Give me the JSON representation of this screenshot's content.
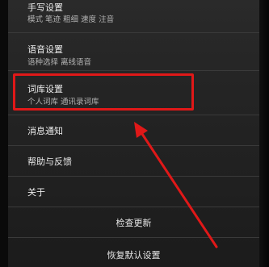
{
  "settings": {
    "items": [
      {
        "title": "手写设置",
        "subtitle": "模式 笔迹 粗细 速度 注音"
      },
      {
        "title": "语音设置",
        "subtitle": "语种选择 离线语音"
      },
      {
        "title": "词库设置",
        "subtitle": "个人词库 通讯录词库"
      },
      {
        "title": "消息通知"
      },
      {
        "title": "帮助与反馈"
      },
      {
        "title": "关于"
      }
    ],
    "check_update": "检查更新",
    "restore_default": "恢复默认设置"
  },
  "colors": {
    "annotation": "#e01818",
    "background": "#242424",
    "text_primary": "#ececec",
    "text_secondary": "#b4b4b4"
  }
}
